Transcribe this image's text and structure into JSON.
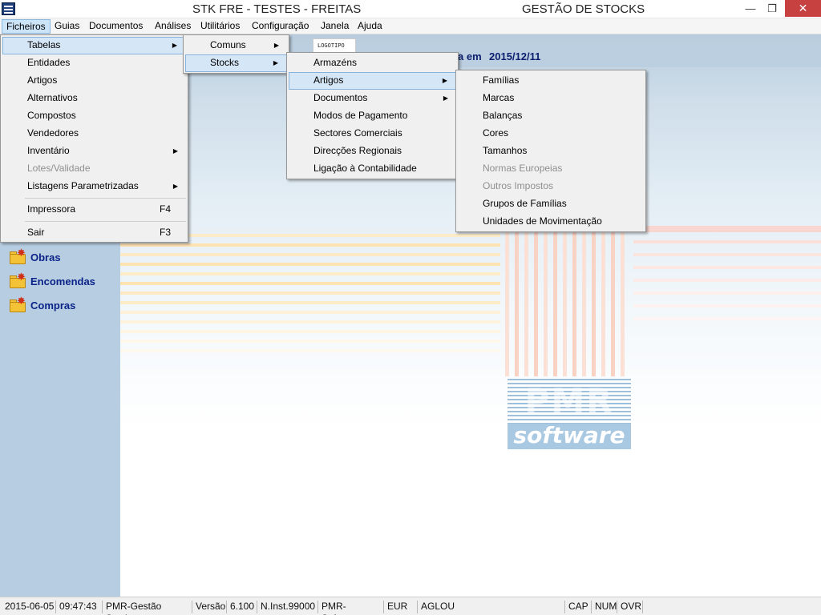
{
  "window": {
    "title_left": "STK FRE - TESTES - FREITAS",
    "title_right": "GESTÃO DE STOCKS",
    "minimize": "—",
    "maximize": "❐",
    "close": "✕"
  },
  "menubar": [
    {
      "label": "Ficheiros"
    },
    {
      "label": "Guias"
    },
    {
      "label": "Documentos"
    },
    {
      "label": "Análises"
    },
    {
      "label": "Utilitários"
    },
    {
      "label": "Configuração"
    },
    {
      "label": "Janela"
    },
    {
      "label": "Ajuda"
    }
  ],
  "header": {
    "logo_text": "LOGOTIPO",
    "date_prefix": "a em",
    "date": "2015/12/11"
  },
  "sidebar": {
    "items": [
      {
        "label": "Obras",
        "icon": "folder-icon"
      },
      {
        "label": "Encomendas",
        "icon": "folder-icon"
      },
      {
        "label": "Compras",
        "icon": "folder-icon"
      }
    ]
  },
  "menus": {
    "ficheiros": {
      "items": [
        {
          "label": "Tabelas",
          "submenu": true
        },
        {
          "label": "Entidades"
        },
        {
          "label": "Artigos"
        },
        {
          "label": "Alternativos"
        },
        {
          "label": "Compostos"
        },
        {
          "label": "Vendedores"
        },
        {
          "label": "Inventário",
          "submenu": true
        },
        {
          "label": "Lotes/Validade",
          "disabled": true
        },
        {
          "label": "Listagens Parametrizadas",
          "submenu": true
        },
        {
          "label": "Impressora",
          "shortcut": "F4"
        },
        {
          "label": "Sair",
          "shortcut": "F3"
        }
      ]
    },
    "tabelas": {
      "items": [
        {
          "label": "Comuns",
          "submenu": true
        },
        {
          "label": "Stocks",
          "submenu": true
        }
      ]
    },
    "stocks": {
      "items": [
        {
          "label": "Armazéns"
        },
        {
          "label": "Artigos",
          "submenu": true
        },
        {
          "label": "Documentos",
          "submenu": true
        },
        {
          "label": "Modos de Pagamento"
        },
        {
          "label": "Sectores Comerciais"
        },
        {
          "label": "Direcções Regionais"
        },
        {
          "label": "Ligação à Contabilidade"
        }
      ]
    },
    "artigos": {
      "items": [
        {
          "label": "Famílias"
        },
        {
          "label": "Marcas"
        },
        {
          "label": "Balanças"
        },
        {
          "label": "Cores"
        },
        {
          "label": "Tamanhos"
        },
        {
          "label": "Normas Europeias",
          "disabled": true
        },
        {
          "label": "Outros Impostos",
          "disabled": true
        },
        {
          "label": "Grupos de Famílias"
        },
        {
          "label": "Unidades de Movimentação"
        }
      ]
    }
  },
  "logo": {
    "pmr": "PMR",
    "software": "software"
  },
  "statusbar": {
    "date": "2015-06-05",
    "time": "09:47:43",
    "app": "PMR-Gestão Stocks",
    "version_label": "Versão",
    "version": "6.100",
    "install": "N.Inst.99000",
    "company": "PMR-Software",
    "currency": "EUR",
    "user": "AGLOU",
    "cap": "CAP",
    "num": "NUM",
    "ovr": "OVR"
  },
  "colors": {
    "sidebar_bg": "#b7cee2",
    "sidebar_text": "#0b2388",
    "menu_highlight": "#d5e6f6",
    "close_button": "#c74141"
  }
}
